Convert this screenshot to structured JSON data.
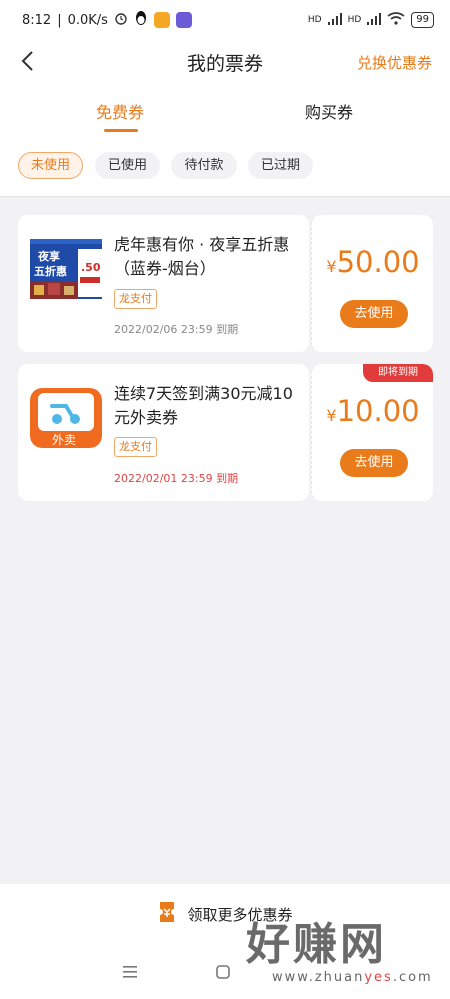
{
  "status_bar": {
    "time": "8:12",
    "net_speed": "0.0K/s",
    "signal_label_1": "HD",
    "signal_label_2": "HD",
    "battery": "99",
    "colors": {
      "app1": "#f5a623",
      "app2": "#6b5bd6"
    }
  },
  "header": {
    "title": "我的票券",
    "back_icon": "chevron-left-icon",
    "action_label": "兑换优惠券"
  },
  "tabs": [
    {
      "label": "免费券",
      "active": true
    },
    {
      "label": "购买券",
      "active": false
    }
  ],
  "filters": [
    {
      "label": "未使用",
      "active": true
    },
    {
      "label": "已使用",
      "active": false
    },
    {
      "label": "待付款",
      "active": false
    },
    {
      "label": "已过期",
      "active": false
    }
  ],
  "coupons": [
    {
      "name": "虎年惠有你 · 夜享五折惠（蓝券-烟台）",
      "tag": "龙支付",
      "expiry": "2022/02/06 23:59 到期",
      "currency": "¥",
      "amount": "50.00",
      "button": "去使用",
      "thumb": {
        "line1": "夜享",
        "line2": "五折惠",
        "value": ".50"
      }
    },
    {
      "name": "连续7天签到满30元减10元外卖券",
      "tag": "龙支付",
      "expiry": "2022/02/01 23:59 到期",
      "currency": "¥",
      "amount": "10.00",
      "button": "去使用",
      "badge": "即将到期",
      "thumb": {
        "label": "外卖"
      }
    }
  ],
  "bottom_action": {
    "label": "领取更多优惠券",
    "icon": "ticket-icon"
  },
  "watermark": {
    "big": "好赚网",
    "small_1": "www.zhuan",
    "small_2": "yes",
    "small_3": ".com"
  },
  "theme": {
    "accent": "#ea7b1a",
    "danger": "#e23b3b"
  }
}
